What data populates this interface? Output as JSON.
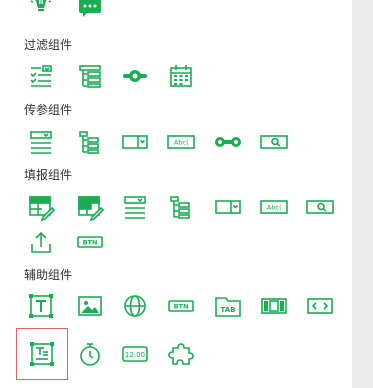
{
  "theme": {
    "accent": "#1aad53",
    "selected_border": "#e06666",
    "scrollbar": "#ebebeb"
  },
  "sections": {
    "filter": {
      "title": "过滤组件"
    },
    "param": {
      "title": "传参组件"
    },
    "fill": {
      "title": "填报组件"
    },
    "aux": {
      "title": "辅助组件"
    }
  },
  "icon_labels": {
    "abc": "Abc|",
    "btn": "BTN",
    "tab": "TAB",
    "time": "12:00"
  },
  "top_icons": [
    "lightbulb-chart-icon",
    "chat-message-icon"
  ],
  "filter_icons": [
    "checklist-dropdown-icon",
    "tree-list-icon",
    "slider-icon",
    "calendar-icon"
  ],
  "param_icons": [
    "list-dropdown-icon",
    "tree-list-icon",
    "select-dropdown-icon",
    "text-input-icon",
    "range-slider-icon",
    "search-box-icon"
  ],
  "fill_icons": [
    "table-edit-icon",
    "table-edit-icon",
    "list-dropdown-icon",
    "tree-list-icon",
    "select-dropdown-icon",
    "text-input-icon",
    "search-box-icon",
    "upload-icon",
    "button-icon"
  ],
  "aux_icons": [
    "text-icon",
    "image-icon",
    "globe-icon",
    "button-icon",
    "tab-icon",
    "carousel-icon",
    "pager-icon",
    "rich-text-icon",
    "timer-icon",
    "clock-display-icon",
    "plugin-icon"
  ],
  "selected_component": "rich-text-icon"
}
